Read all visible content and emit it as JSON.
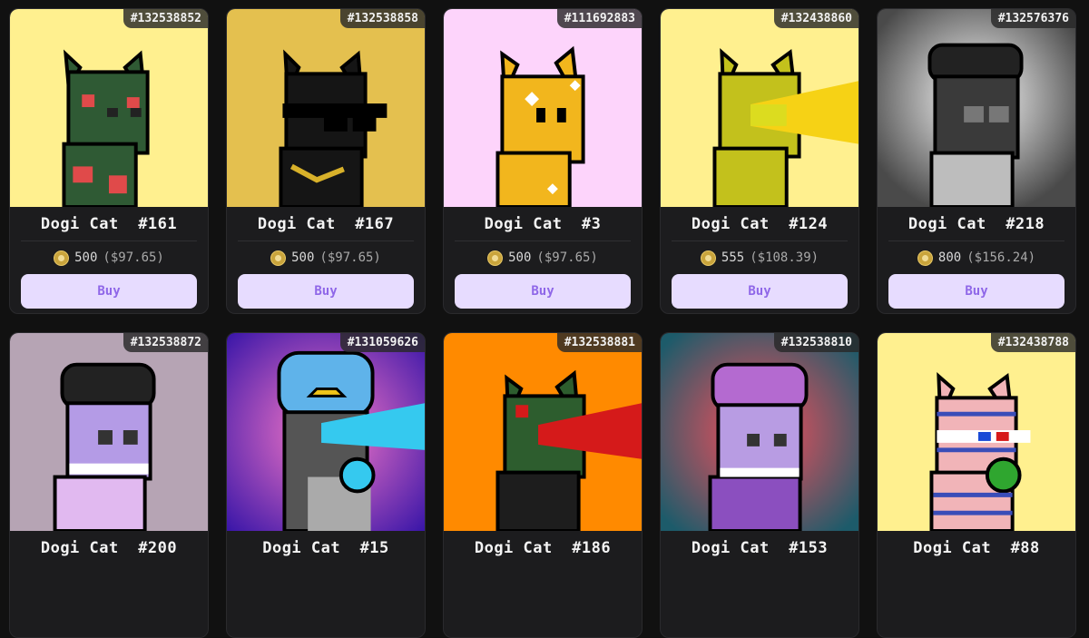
{
  "listings": [
    {
      "inscription": "#132538852",
      "name": "Dogi Cat  #161",
      "amount": "500",
      "usd": "($97.65)",
      "buy_label": "Buy"
    },
    {
      "inscription": "#132538858",
      "name": "Dogi Cat  #167",
      "amount": "500",
      "usd": "($97.65)",
      "buy_label": "Buy"
    },
    {
      "inscription": "#111692883",
      "name": "Dogi Cat  #3",
      "amount": "500",
      "usd": "($97.65)",
      "buy_label": "Buy"
    },
    {
      "inscription": "#132438860",
      "name": "Dogi Cat  #124",
      "amount": "555",
      "usd": "($108.39)",
      "buy_label": "Buy"
    },
    {
      "inscription": "#132576376",
      "name": "Dogi Cat  #218",
      "amount": "800",
      "usd": "($156.24)",
      "buy_label": "Buy"
    },
    {
      "inscription": "#132538872",
      "name": "Dogi Cat  #200"
    },
    {
      "inscription": "#131059626",
      "name": "Dogi Cat  #15"
    },
    {
      "inscription": "#132538881",
      "name": "Dogi Cat  #186"
    },
    {
      "inscription": "#132538810",
      "name": "Dogi Cat  #153"
    },
    {
      "inscription": "#132438788",
      "name": "Dogi Cat  #88"
    }
  ],
  "art": [
    {
      "bg": "#fff08f",
      "body": "#2f5a34",
      "accent": "#e04a4a"
    },
    {
      "bg": "#e4c04f",
      "body": "#151515",
      "accent": "#d8b12a"
    },
    {
      "bg": "#fdd4fb",
      "body": "#f2b61d",
      "accent": "#ffffff"
    },
    {
      "bg": "#fff08f",
      "body": "#c3c11c",
      "accent": "#f6d215"
    },
    {
      "bg": "#cfcfcf",
      "body": "#3a3a3a",
      "accent": "#222222"
    },
    {
      "bg": "#b6a4b4",
      "body": "#b49be6",
      "accent": "#222222"
    },
    {
      "bg": "#6a2fb0",
      "body": "#5fb3ea",
      "accent": "#35c9ef"
    },
    {
      "bg": "#ff8a00",
      "body": "#2d5d2e",
      "accent": "#d51a1a"
    },
    {
      "bg": "#2c6d6e",
      "body": "#b89ce3",
      "accent": "#b46ad0"
    },
    {
      "bg": "#fff08f",
      "body": "#f1b4b8",
      "accent": "#2fa62f"
    }
  ]
}
